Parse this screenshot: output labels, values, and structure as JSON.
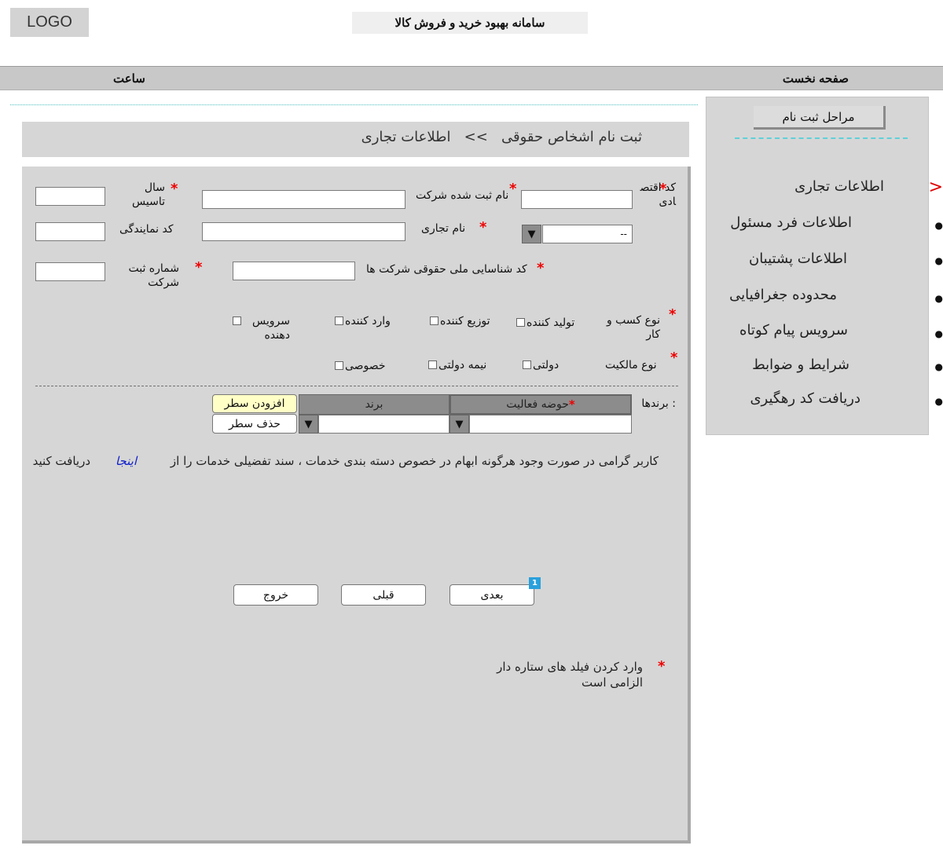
{
  "header": {
    "logo": "LOGO",
    "system_title": "سامانه بهبود خرید و فروش کالا"
  },
  "nav": {
    "home": "صفحه نخست",
    "clock": "ساعت"
  },
  "sidebar": {
    "steps_button": "مراحل ثبت نام",
    "items": [
      {
        "label": "اطلاعات تجاری",
        "marker": "<"
      },
      {
        "label": "اطلاعات فرد مسئول",
        "marker": "●"
      },
      {
        "label": "اطلاعات پشتیبان",
        "marker": "●"
      },
      {
        "label": "محدوده جغرافیایی",
        "marker": "●"
      },
      {
        "label": "سرویس پیام کوتاه",
        "marker": "●"
      },
      {
        "label": "شرایط و ضوابط",
        "marker": "●"
      },
      {
        "label": "دریافت کد رهگیری",
        "marker": "●"
      }
    ]
  },
  "breadcrumb": {
    "part1": "ثبت نام اشخاص حقوقی",
    "separator": ">>",
    "part2": "اطلاعات تجاری"
  },
  "form": {
    "star": "*",
    "economic_code_label": "کد اقتصادی",
    "registered_name_label": "نام ثبت شده شرکت",
    "founding_year_label": "سال تاسیس",
    "activity_select_value": "--",
    "trade_name_label": "نام تجاری",
    "agency_code_label": "کد نمایندگی",
    "national_id_label": "کد شناسایی ملی حقوقی شرکت ها",
    "company_reg_number_label": "شماره ثبت شرکت",
    "business_type_label": "نوع کسب و کار",
    "business_types": [
      "تولید کننده",
      "توزیع کننده",
      "وارد کننده",
      "سرویس دهنده"
    ],
    "ownership_label": "نوع مالکیت",
    "ownership_types": [
      "دولتی",
      "نیمه دولتی",
      "خصوصی"
    ],
    "brands_label": ": برندها",
    "col_activity": "حوضه فعالیت",
    "col_brand": "برند",
    "add_row": "افزودن سطر",
    "delete_row": "حذف سطر"
  },
  "notice": {
    "text_before": "کاربر گرامی در صورت  وجود هرگونه ابهام در خصوص دسته بندی خدمات ، سند تفضیلی خدمات را  از",
    "link": "اینجا",
    "text_after": "دریافت کنید"
  },
  "buttons": {
    "next": "بعدی",
    "prev": "قبلی",
    "exit": "خروج",
    "next_badge": "1"
  },
  "required_note": "وارد کردن فیلد های ستاره دار الزامی است"
}
